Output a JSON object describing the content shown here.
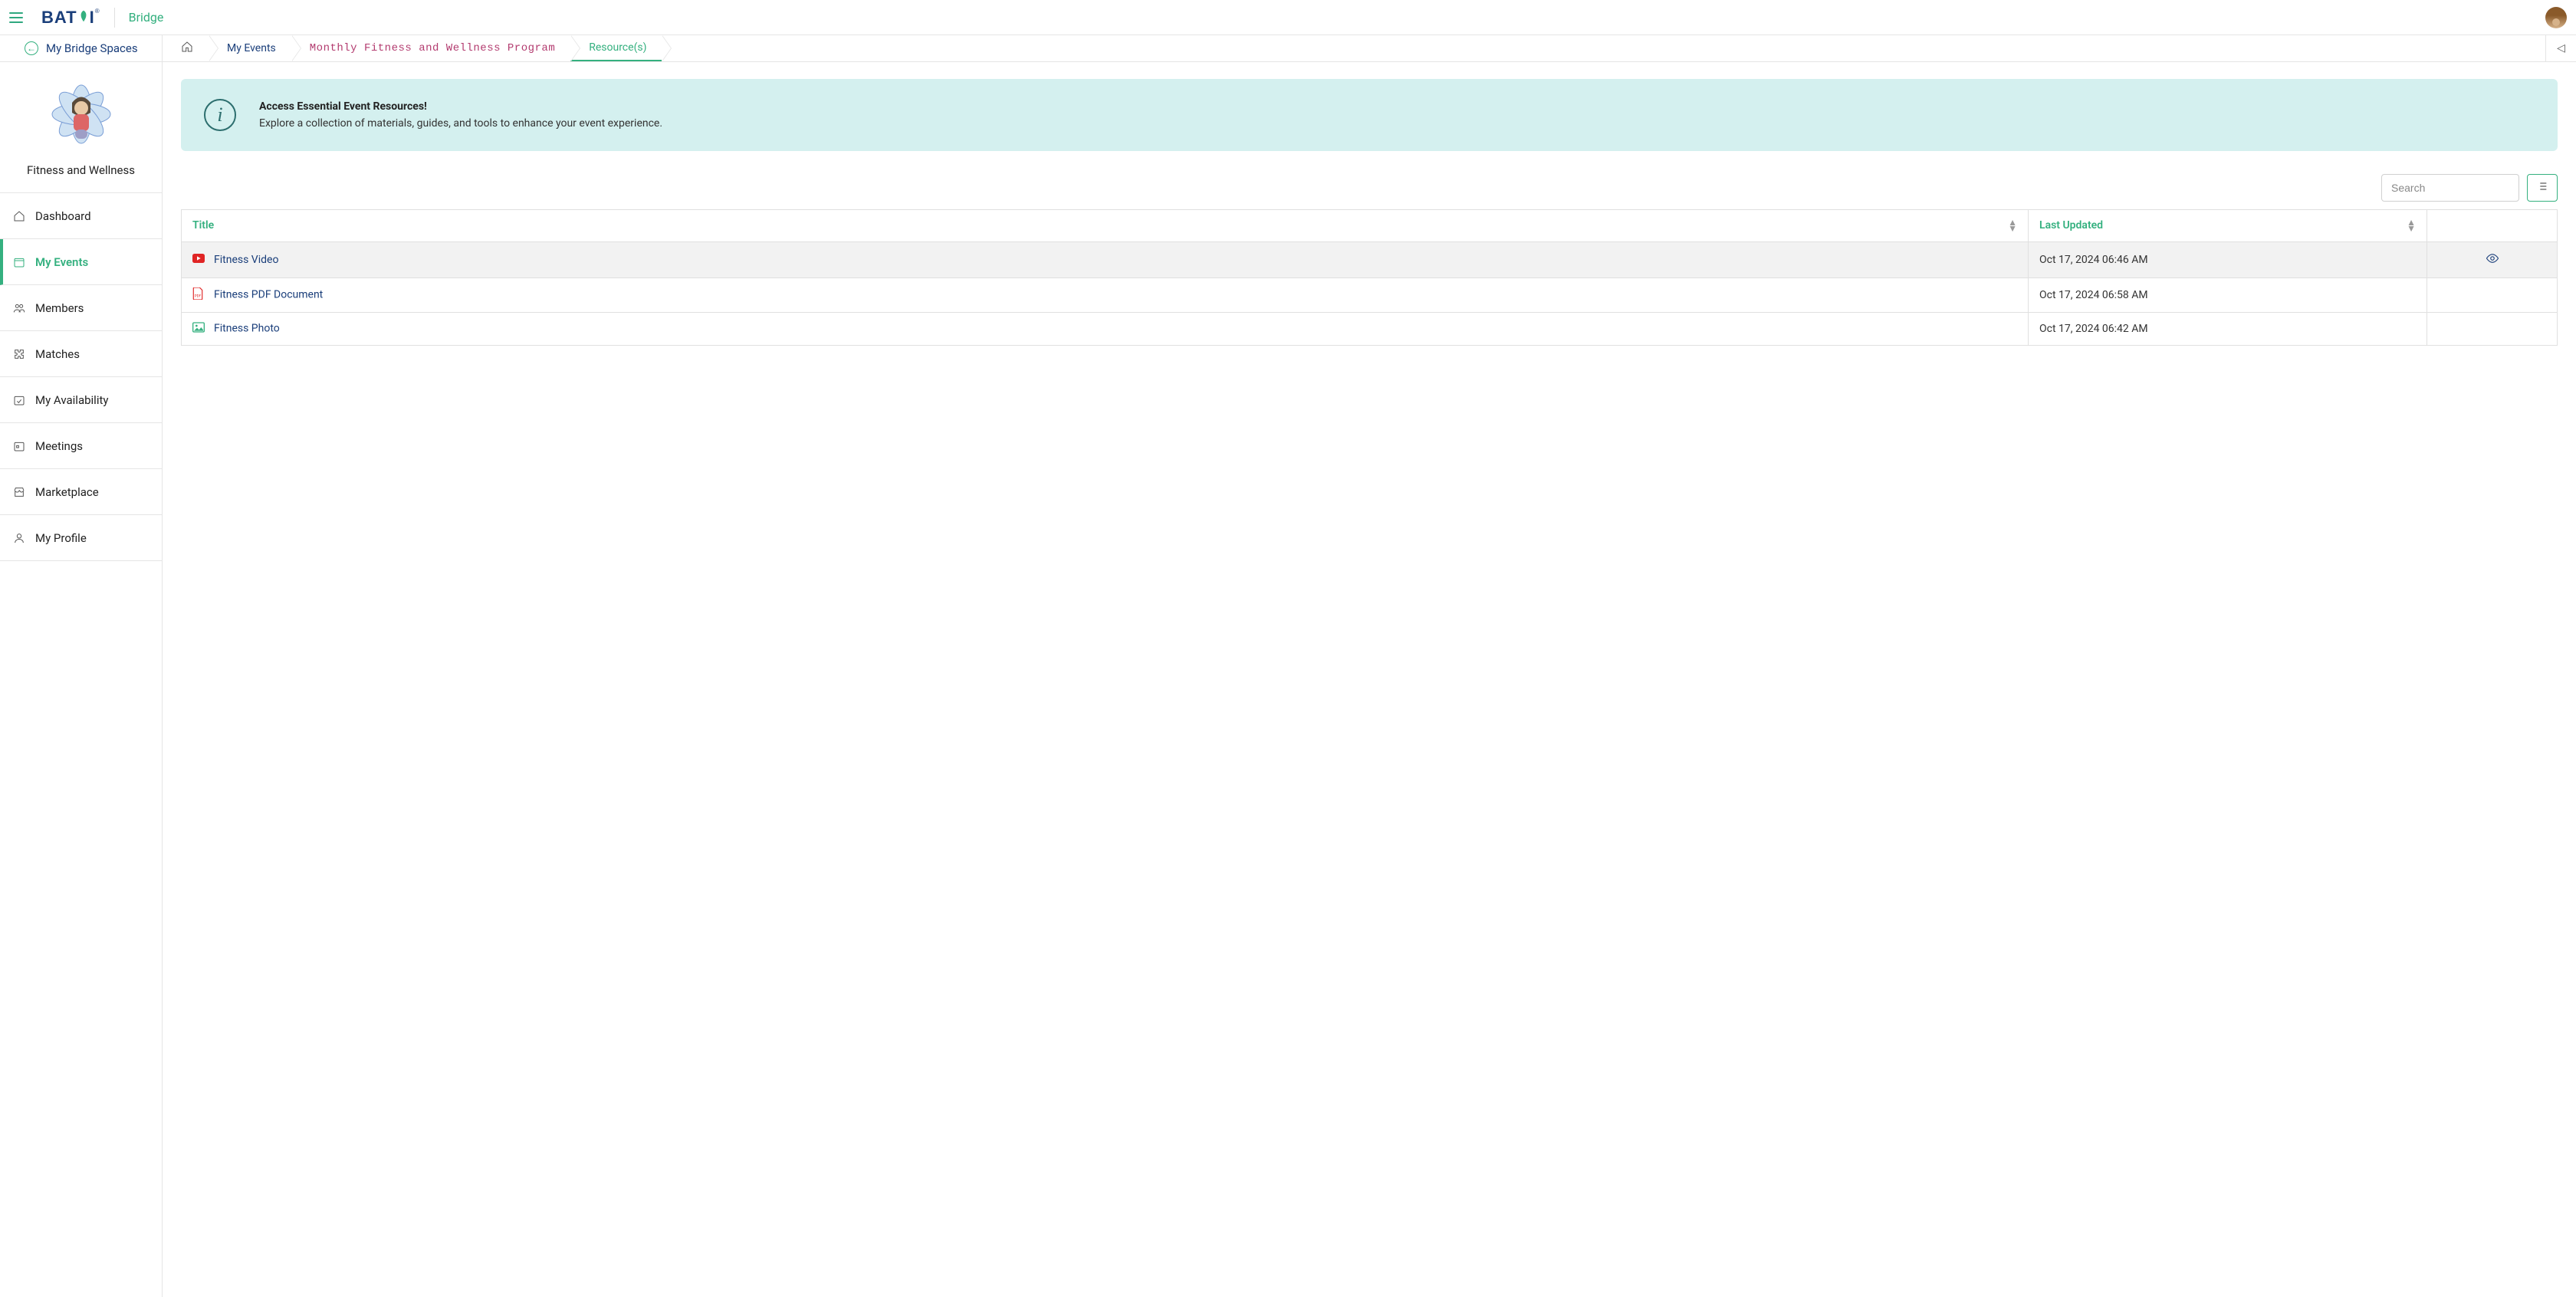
{
  "topbar": {
    "logo_text": "BAT",
    "logo_text2": "I",
    "logo_mark": "®",
    "product": "Bridge"
  },
  "subbar": {
    "back_label": "My Bridge Spaces",
    "crumbs": {
      "events": "My Events",
      "program": "Monthly Fitness and Wellness Program",
      "resources": "Resource(s)"
    }
  },
  "sidebar": {
    "space_name": "Fitness and Wellness",
    "items": [
      {
        "label": "Dashboard"
      },
      {
        "label": "My Events"
      },
      {
        "label": "Members"
      },
      {
        "label": "Matches"
      },
      {
        "label": "My Availability"
      },
      {
        "label": "Meetings"
      },
      {
        "label": "Marketplace"
      },
      {
        "label": "My Profile"
      }
    ],
    "active_index": 1
  },
  "notice": {
    "title": "Access Essential Event Resources!",
    "body": "Explore a collection of materials, guides, and tools to enhance your event experience."
  },
  "search": {
    "placeholder": "Search",
    "value": ""
  },
  "table": {
    "columns": {
      "title": "Title",
      "last_updated": "Last Updated"
    },
    "rows": [
      {
        "type": "video",
        "title": "Fitness Video",
        "updated": "Oct 17, 2024 06:46 AM",
        "hovered": true
      },
      {
        "type": "pdf",
        "title": "Fitness PDF Document",
        "updated": "Oct 17, 2024 06:58 AM",
        "hovered": false
      },
      {
        "type": "image",
        "title": "Fitness Photo",
        "updated": "Oct 17, 2024 06:42 AM",
        "hovered": false
      }
    ]
  },
  "icons": {
    "home": "home-icon",
    "back_triangle": "collapse-right-icon"
  }
}
